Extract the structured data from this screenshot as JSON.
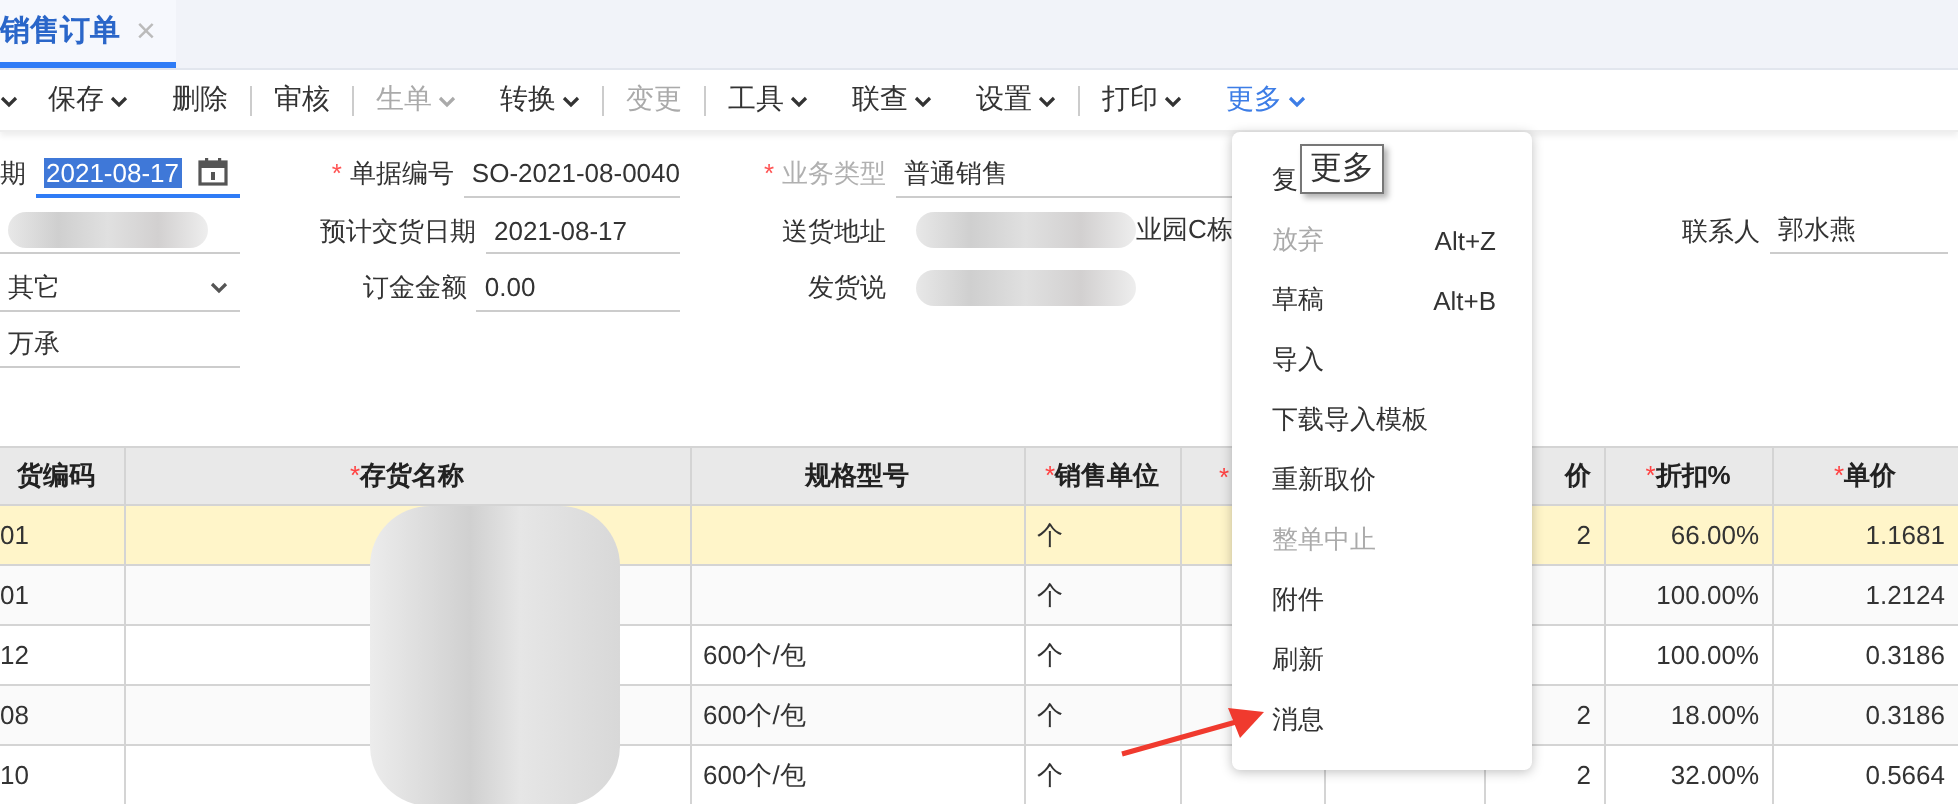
{
  "tab": {
    "label": "销售订单",
    "selected": true,
    "close": "×"
  },
  "toolbar": [
    {
      "dropdown": true,
      "disabled": false,
      "divider_after": false,
      "selected": false
    },
    {
      "label": "保存",
      "dropdown": true,
      "disabled": false,
      "divider_after": false,
      "selected": false
    },
    {
      "label": "删除",
      "dropdown": false,
      "disabled": false,
      "divider_after": true,
      "selected": false
    },
    {
      "label": "审核",
      "dropdown": false,
      "disabled": false,
      "divider_after": true,
      "selected": false
    },
    {
      "label": "生单",
      "dropdown": true,
      "disabled": true,
      "divider_after": false,
      "selected": false
    },
    {
      "label": "转换",
      "dropdown": true,
      "disabled": false,
      "divider_after": true,
      "selected": false
    },
    {
      "label": "变更",
      "dropdown": false,
      "disabled": true,
      "divider_after": true,
      "selected": false
    },
    {
      "label": "工具",
      "dropdown": true,
      "disabled": false,
      "divider_after": false,
      "selected": false
    },
    {
      "label": "联查",
      "dropdown": true,
      "disabled": false,
      "divider_after": false,
      "selected": false
    },
    {
      "label": "设置",
      "dropdown": true,
      "disabled": false,
      "divider_after": true,
      "selected": false
    },
    {
      "label": "打印",
      "dropdown": true,
      "disabled": false,
      "divider_after": false,
      "selected": false
    },
    {
      "label": "更多",
      "dropdown": true,
      "disabled": false,
      "divider_after": false,
      "selected": true
    }
  ],
  "form_rows": [
    [
      {
        "label": "期",
        "kind": "date",
        "value": "2021-08-17",
        "focused": true,
        "disabled": false
      },
      {
        "label": "单据编号",
        "kind": "text",
        "value": "SO-2021-08-0040",
        "required_mark": "*",
        "disabled": false
      },
      {
        "label": "业务类型",
        "kind": "text",
        "value": "普通销售",
        "required_mark": "*",
        "disabled": true
      },
      null
    ],
    [
      {
        "kind": "blurred"
      },
      {
        "label": "预计交货日期",
        "kind": "text",
        "value": "2021-08-17",
        "disabled": false
      },
      {
        "label": "送货地址",
        "kind": "blurred_text",
        "value": "业园C栋",
        "disabled": false
      },
      {
        "label": "联系人",
        "kind": "text",
        "value": "郭水燕",
        "disabled": false
      }
    ],
    [
      {
        "kind": "select",
        "value": "其它"
      },
      {
        "label": "订金金额",
        "kind": "text",
        "value": "0.00",
        "disabled": false
      },
      {
        "label": "发货说",
        "kind": "blurred_text",
        "disabled": false
      },
      null
    ],
    [
      {
        "kind": "text",
        "value": "万承"
      },
      null,
      null,
      null
    ]
  ],
  "table": {
    "columns": [
      {
        "label": "货编码"
      },
      {
        "label": "存货名称",
        "required_mark": "*"
      },
      {
        "label": "规格型号"
      },
      {
        "label": "销售单位",
        "required_mark": "*"
      },
      {
        "required_mark": "*"
      },
      {},
      {
        "label": "价"
      },
      {
        "label": "折扣%",
        "required_mark": "*"
      },
      {
        "label": "单价",
        "required_mark": "*"
      }
    ],
    "rows": [
      {
        "selected": true,
        "cells": [
          "01",
          "",
          "",
          "个",
          "",
          "",
          "2",
          "66.00%",
          "1.1681"
        ]
      },
      {
        "selected": false,
        "cells": [
          "01",
          "",
          "",
          "个",
          "",
          "",
          "",
          "100.00%",
          "1.2124"
        ]
      },
      {
        "selected": false,
        "cells": [
          "12",
          "",
          "600个/包",
          "个",
          "",
          "",
          "",
          "100.00%",
          "0.3186"
        ]
      },
      {
        "selected": false,
        "cells": [
          "08",
          "",
          "600个/包",
          "个",
          "",
          "",
          "2",
          "18.00%",
          "0.3186"
        ]
      },
      {
        "selected": false,
        "cells": [
          "10",
          "",
          "600个/包",
          "个",
          "",
          "",
          "2",
          "32.00%",
          "0.5664"
        ]
      }
    ]
  },
  "menu": {
    "items": [
      {
        "label": "复",
        "disabled": false
      },
      {
        "label": "放弃",
        "shortcut": "Alt+Z",
        "disabled": true
      },
      {
        "label": "草稿",
        "shortcut": "Alt+B",
        "disabled": false
      },
      {
        "label": "导入",
        "disabled": false
      },
      {
        "label": "下载导入模板",
        "disabled": false
      },
      {
        "label": "重新取价",
        "disabled": false
      },
      {
        "label": "整单中止",
        "disabled": true
      },
      {
        "label": "附件",
        "disabled": false
      },
      {
        "label": "刷新",
        "disabled": false
      },
      {
        "label": "消息",
        "disabled": false
      }
    ],
    "tooltip": "更多"
  }
}
